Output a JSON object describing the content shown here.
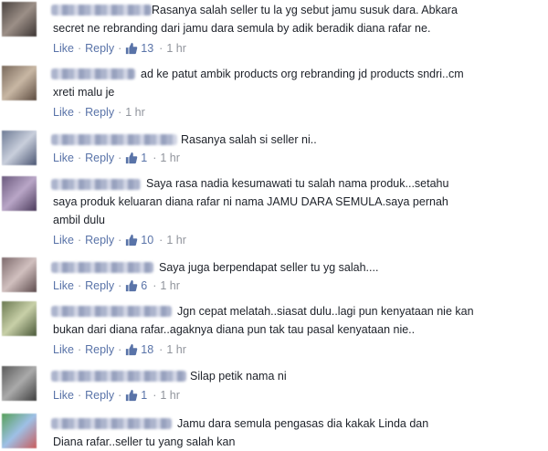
{
  "labels": {
    "like": "Like",
    "reply": "Reply",
    "sep": "·"
  },
  "comments": [
    {
      "text": "Rasanya salah seller tu la yg sebut jamu susuk dara. Abkara\nsecret ne rebranding dari jamu dara semula by adik beradik diana rafar ne.",
      "likes": "13",
      "time": "1 hr"
    },
    {
      "text": "ad ke patut ambik products org rebranding jd products sndri..cm\nxreti malu je",
      "likes": "",
      "time": "1 hr"
    },
    {
      "text": "Rasanya salah si seller ni..",
      "likes": "1",
      "time": "1 hr"
    },
    {
      "text": "Saya rasa nadia kesumawati tu salah nama produk...setahu\nsaya produk keluaran diana rafar ni nama JAMU DARA SEMULA.saya pernah\nambil dulu",
      "likes": "10",
      "time": "1 hr"
    },
    {
      "text": "Saya juga berpendapat seller tu yg salah....",
      "likes": "6",
      "time": "1 hr"
    },
    {
      "text": "Jgn cepat melatah..siasat dulu..lagi pun kenyataan nie kan\nbukan dari diana rafar..agaknya diana pun tak tau pasal kenyataan nie..",
      "likes": "18",
      "time": "1 hr"
    },
    {
      "text": "Silap petik nama ni",
      "likes": "1",
      "time": "1 hr"
    },
    {
      "text": "Jamu dara semula pengasas dia kakak Linda dan\nDiana rafar..seller tu yang salah kan",
      "likes": "",
      "time": ""
    }
  ],
  "colors": {
    "link": "#5973a8",
    "meta": "#90949c",
    "text": "#1d2129"
  },
  "icons": {
    "like": "thumbs-up-icon"
  }
}
